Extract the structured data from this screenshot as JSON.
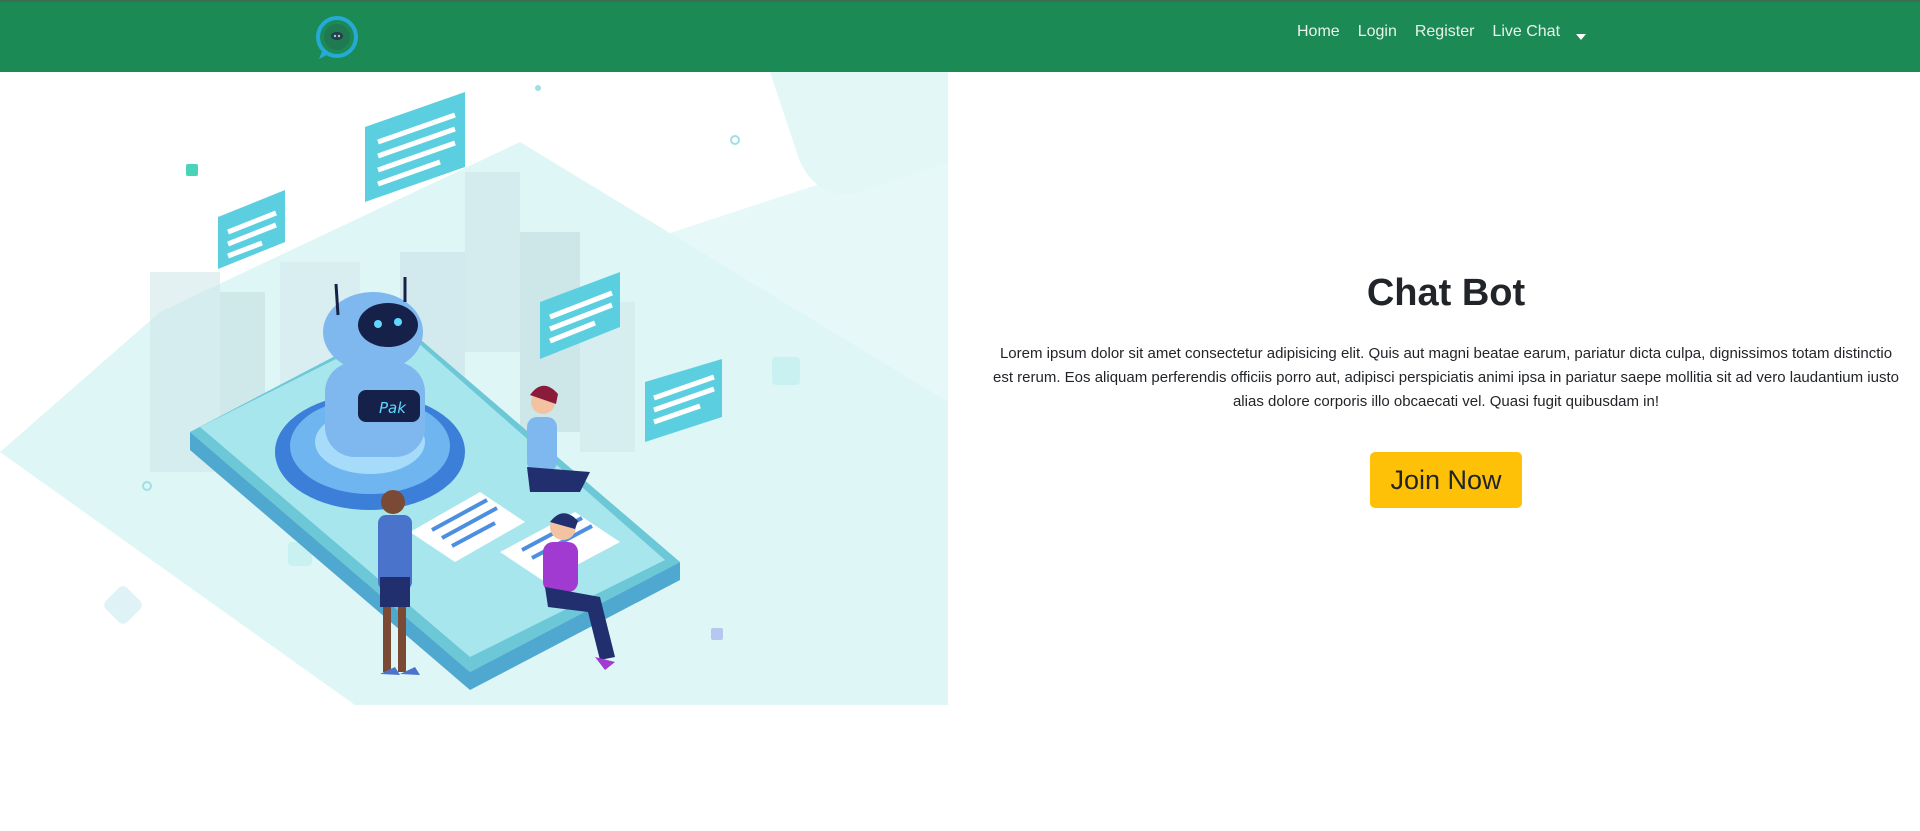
{
  "navbar": {
    "logo_icon": "chat-bubble-robot-logo",
    "links": [
      {
        "label": "Home"
      },
      {
        "label": "Login"
      },
      {
        "label": "Register"
      },
      {
        "label": "Live Chat"
      }
    ],
    "dropdown_icon": "caret-down-icon"
  },
  "hero": {
    "title": "Chat Bot",
    "description": "Lorem ipsum dolor sit amet consectetur adipisicing elit. Quis aut magni beatae earum, pariatur dicta culpa, dignissimos totam distinctio est rerum. Eos aliquam perferendis officiis porro aut, adipisci perspiciatis animi ipsa in pariatur saepe mollitia sit ad vero laudantium iusto alias dolore corporis illo obcaecati vel. Quasi fugit quibusdam in!",
    "join_label": "Join Now",
    "robot_badge": "Pak"
  },
  "colors": {
    "navbar_bg": "#1b8a55",
    "accent_button": "#ffc107",
    "illustration_teal": "#5bcfe0"
  }
}
